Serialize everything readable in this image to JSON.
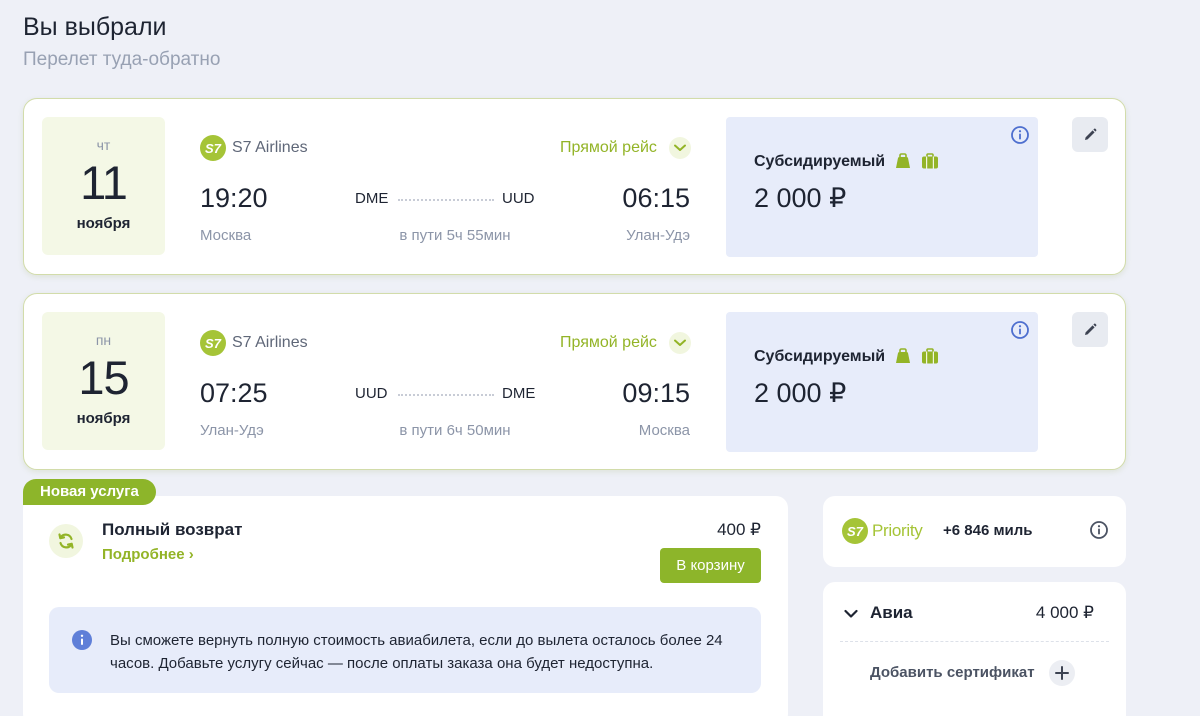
{
  "page": {
    "title": "Вы выбрали",
    "subtitle": "Перелет туда-обратно"
  },
  "flights": [
    {
      "dow": "чт",
      "day": "11",
      "month": "ноября",
      "airline": "S7 Airlines",
      "airline_logo": "S7",
      "direct_label": "Прямой рейс",
      "dep_time": "19:20",
      "arr_time": "06:15",
      "dep_code": "DME",
      "arr_code": "UUD",
      "dep_city": "Москва",
      "arr_city": "Улан-Удэ",
      "duration": "в пути 5ч 55мин",
      "fare_name": "Субсидируемый",
      "fare_price": "2 000 ₽",
      "fare_icons": [
        "hand-luggage-icon",
        "baggage-icon"
      ]
    },
    {
      "dow": "пн",
      "day": "15",
      "month": "ноября",
      "airline": "S7 Airlines",
      "airline_logo": "S7",
      "direct_label": "Прямой рейс",
      "dep_time": "07:25",
      "arr_time": "09:15",
      "dep_code": "UUD",
      "arr_code": "DME",
      "dep_city": "Улан-Удэ",
      "arr_city": "Москва",
      "duration": "в пути 6ч 50мин",
      "fare_name": "Субсидируемый",
      "fare_price": "2 000 ₽",
      "fare_icons": [
        "hand-luggage-icon",
        "baggage-icon"
      ]
    }
  ],
  "service": {
    "badge": "Новая услуга",
    "title": "Полный возврат",
    "more_label": "Подробнее ›",
    "price": "400 ₽",
    "cart_label": "В корзину",
    "note": "Вы сможете вернуть полную стоимость авиабилета, если до вылета осталось более 24 часов. Добавьте услугу сейчас — после оплаты заказа она будет недоступна."
  },
  "priority": {
    "logo": "S7",
    "word": "Priority",
    "miles": "+6 846 миль"
  },
  "summary": {
    "avia_label": "Авиа",
    "avia_price": "4 000 ₽",
    "cert_label": "Добавить сертификат"
  },
  "colors": {
    "accent_green": "#8db52a",
    "fare_bg": "#e7ecfa",
    "date_bg": "#f4f8e6",
    "page_bg": "#eef0f7"
  }
}
